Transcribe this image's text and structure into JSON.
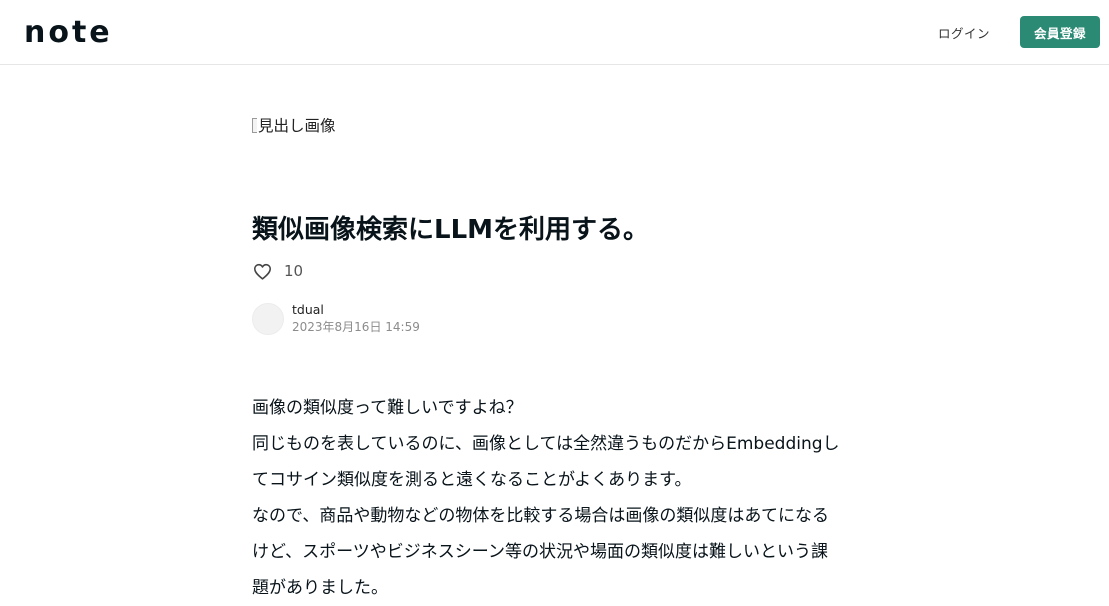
{
  "header": {
    "logo": "note",
    "login_label": "ログイン",
    "signup_label": "会員登録",
    "signup_color": "#2a8a74"
  },
  "article": {
    "hero_image_alt": "見出し画像",
    "title": "類似画像検索にLLMを利用する。",
    "like_icon": "heart-icon",
    "like_count": "10",
    "author_name": "tdual",
    "published_at": "2023年8月16日 14:59",
    "body_lines": [
      "画像の類似度って難しいですよね？",
      "同じものを表しているのに、画像としては全然違うものだからEmbeddingし",
      "てコサイン類似度を測ると遠くなることがよくあります。",
      "なので、商品や動物などの物体を比較する場合は画像の類似度はあてになる",
      "けど、スポーツやビジネスシーン等の状況や場面の類似度は難しいという課",
      "題がありました。"
    ]
  }
}
